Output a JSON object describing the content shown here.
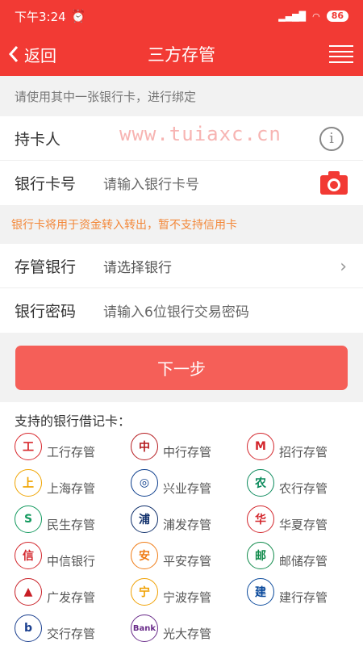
{
  "status": {
    "time": "下午3:24",
    "battery": "86"
  },
  "nav": {
    "back_label": "返回",
    "title": "三方存管"
  },
  "hint": "请使用其中一张银行卡，进行绑定",
  "watermark": "www.tuiaxc.cn",
  "form": {
    "holder_label": "持卡人",
    "card_label": "银行卡号",
    "card_placeholder": "请输入银行卡号",
    "note": "银行卡将用于资金转入转出，暂不支持信用卡",
    "bank_label": "存管银行",
    "bank_placeholder": "请选择银行",
    "password_label": "银行密码",
    "password_placeholder": "请输入6位银行交易密码"
  },
  "next_label": "下一步",
  "banks_title": "支持的银行借记卡：",
  "banks": [
    {
      "name": "工行存管",
      "glyph": "工",
      "color": "#d8262b"
    },
    {
      "name": "中行存管",
      "glyph": "中",
      "color": "#b51b1f"
    },
    {
      "name": "招行存管",
      "glyph": "M",
      "color": "#d3262c"
    },
    {
      "name": "上海存管",
      "glyph": "上",
      "color": "#f0a400"
    },
    {
      "name": "兴业存管",
      "glyph": "◎",
      "color": "#0a3c8c"
    },
    {
      "name": "农行存管",
      "glyph": "农",
      "color": "#0b8a5c"
    },
    {
      "name": "民生存管",
      "glyph": "S",
      "color": "#149a5f"
    },
    {
      "name": "浦发存管",
      "glyph": "浦",
      "color": "#0f2f6b"
    },
    {
      "name": "华夏存管",
      "glyph": "华",
      "color": "#d3262c"
    },
    {
      "name": "中信银行",
      "glyph": "信",
      "color": "#d3262c"
    },
    {
      "name": "平安存管",
      "glyph": "安",
      "color": "#f07b14"
    },
    {
      "name": "邮储存管",
      "glyph": "邮",
      "color": "#0f8a4a"
    },
    {
      "name": "广发存管",
      "glyph": "▲",
      "color": "#c81e25"
    },
    {
      "name": "宁波存管",
      "glyph": "宁",
      "color": "#f0a000"
    },
    {
      "name": "建行存管",
      "glyph": "建",
      "color": "#0b4a9c"
    },
    {
      "name": "交行存管",
      "glyph": "b",
      "color": "#1a3f8f"
    },
    {
      "name": "光大存管",
      "glyph": "Bank",
      "color": "#6a2c8a"
    }
  ]
}
